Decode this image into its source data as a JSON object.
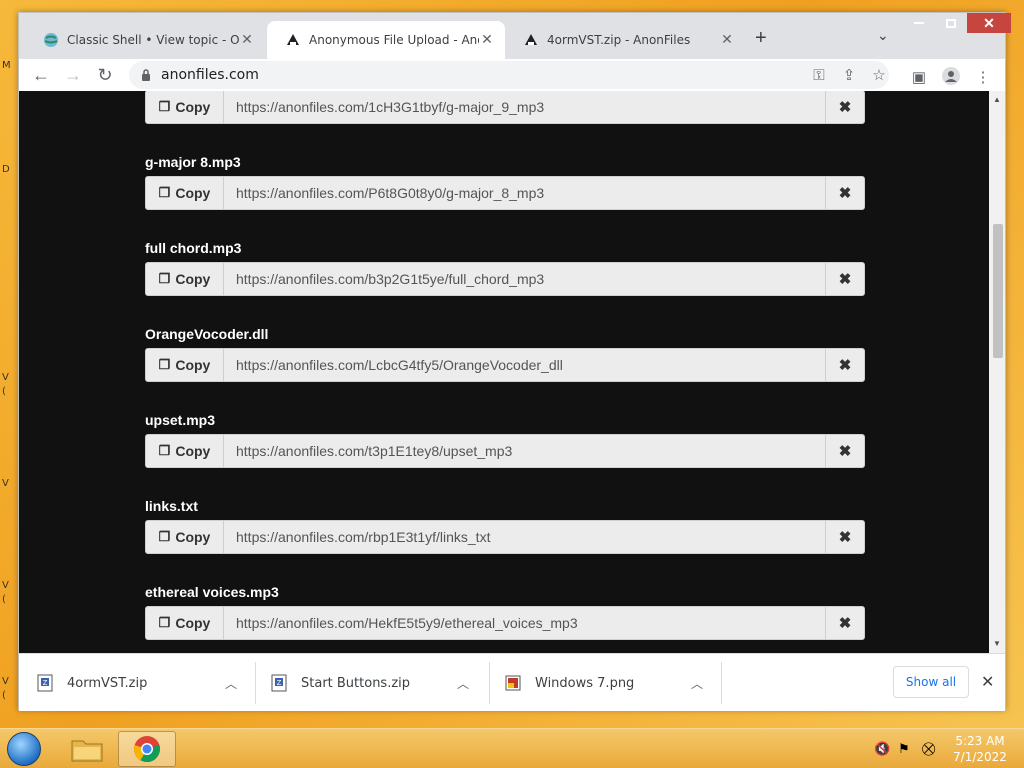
{
  "desktop": {
    "edge_glyphs": [
      "M",
      "D",
      "V",
      "(",
      "V",
      "V",
      "(",
      "V",
      "("
    ]
  },
  "tabs": [
    {
      "title": "Classic Shell • View topic - Original...",
      "favicon": "globe-icon"
    },
    {
      "title": "Anonymous File Upload - AnonFiles",
      "favicon": "anonfiles-icon"
    },
    {
      "title": "4ormVST.zip - AnonFiles",
      "favicon": "anonfiles-icon"
    }
  ],
  "toolbar": {
    "url": "anonfiles.com"
  },
  "uploads": [
    {
      "name": "",
      "link": "https://anonfiles.com/1cH3G1tbyf/g-major_9_mp3"
    },
    {
      "name": "g-major 8.mp3",
      "link": "https://anonfiles.com/P6t8G0t8y0/g-major_8_mp3"
    },
    {
      "name": "full chord.mp3",
      "link": "https://anonfiles.com/b3p2G1t5ye/full_chord_mp3"
    },
    {
      "name": "OrangeVocoder.dll",
      "link": "https://anonfiles.com/LcbcG4tfy5/OrangeVocoder_dll"
    },
    {
      "name": "upset.mp3",
      "link": "https://anonfiles.com/t3p1E1tey8/upset_mp3"
    },
    {
      "name": "links.txt",
      "link": "https://anonfiles.com/rbp1E3t1yf/links_txt"
    },
    {
      "name": "ethereal voices.mp3",
      "link": "https://anonfiles.com/HekfE5t5y9/ethereal_voices_mp3"
    }
  ],
  "copy_label": "Copy",
  "delete_glyph": "✖",
  "downloads": {
    "items": [
      {
        "name": "4ormVST.zip",
        "icon": "zip-file-icon"
      },
      {
        "name": "Start Buttons.zip",
        "icon": "zip-file-icon"
      },
      {
        "name": "Windows 7.png",
        "icon": "image-file-icon"
      }
    ],
    "show_all": "Show all"
  },
  "taskbar": {
    "time": "5:23 AM",
    "date": "7/1/2022"
  },
  "colors": {
    "page_bg": "#111111",
    "accent_blue": "#1a73e8",
    "close_red": "#c7453f"
  }
}
